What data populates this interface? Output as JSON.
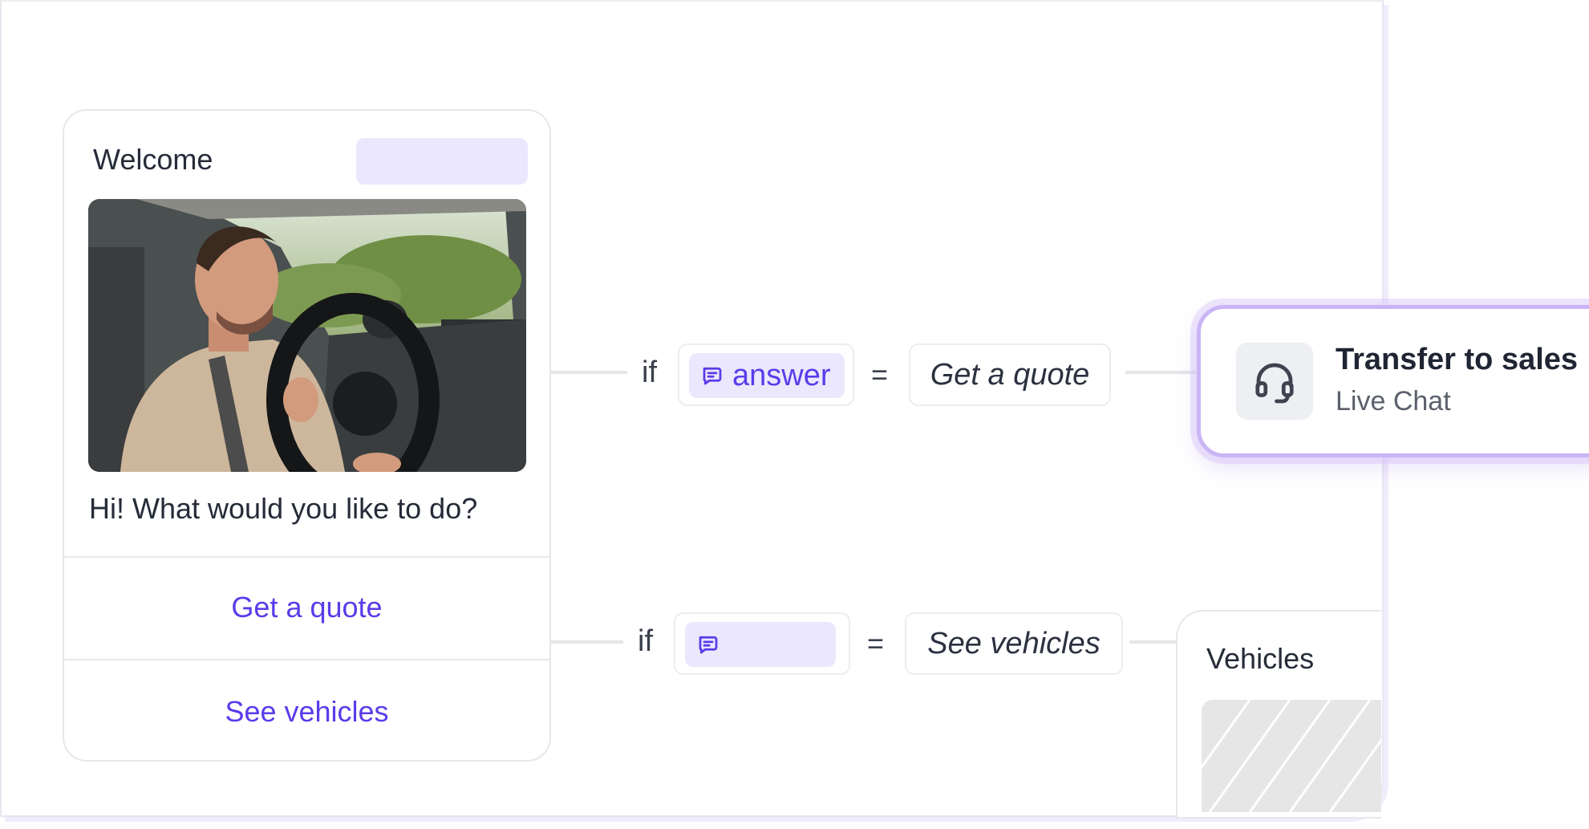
{
  "welcome_card": {
    "title": "Welcome",
    "prompt": "Hi! What would you like to do?",
    "options": [
      "Get a quote",
      "See vehicles"
    ]
  },
  "conditions": [
    {
      "if_label": "if",
      "variable": "answer",
      "operator": "=",
      "value": "Get a quote"
    },
    {
      "if_label": "if",
      "variable": "",
      "operator": "=",
      "value": "See vehicles"
    }
  ],
  "transfer_node": {
    "title": "Transfer to sales",
    "subtitle": "Live Chat",
    "icon": "headset-icon"
  },
  "vehicles_node": {
    "title": "Vehicles"
  },
  "colors": {
    "accent": "#5b3bea",
    "chip_bg": "#ebe8fd",
    "highlight_border": "#c9b5f6"
  }
}
